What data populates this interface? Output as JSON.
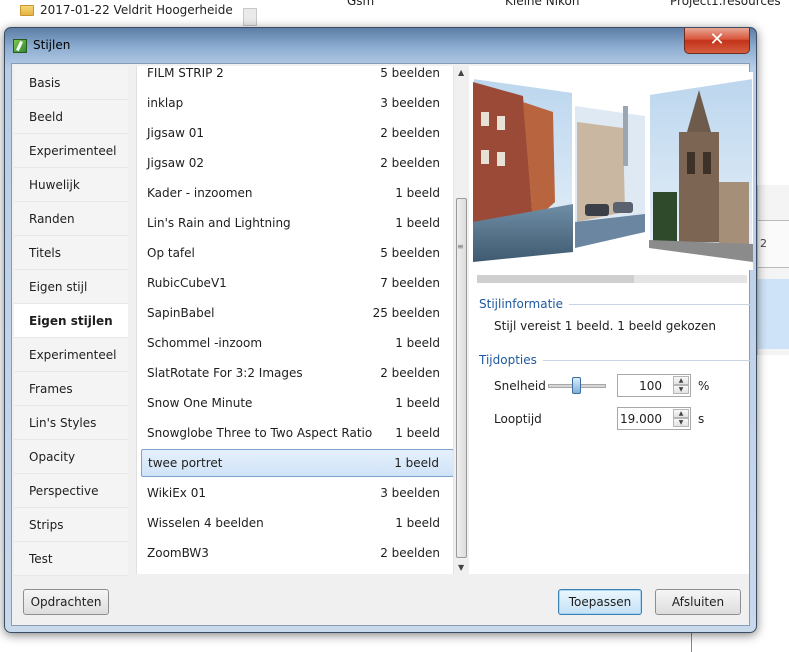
{
  "background": {
    "folder_label": "2017-01-22 Veldrit Hoogerheide",
    "columns": [
      "Gsm",
      "Kleine Nikon",
      "Project1.resources"
    ],
    "ruler_number": "2"
  },
  "dialog": {
    "title": "Stijlen",
    "close_glyph": "✕"
  },
  "categories": [
    {
      "label": "Basis"
    },
    {
      "label": "Beeld"
    },
    {
      "label": "Experimenteel"
    },
    {
      "label": "Huwelijk"
    },
    {
      "label": "Randen"
    },
    {
      "label": "Titels"
    },
    {
      "label": "Eigen stijl"
    },
    {
      "label": "Eigen stijlen",
      "selected": true
    },
    {
      "label": "Experimenteel"
    },
    {
      "label": "Frames"
    },
    {
      "label": "Lin's Styles"
    },
    {
      "label": "Opacity"
    },
    {
      "label": "Perspective"
    },
    {
      "label": "Strips"
    },
    {
      "label": "Test"
    }
  ],
  "styles": [
    {
      "name": "FILM STRIP 2",
      "count": "5 beelden"
    },
    {
      "name": "inklap",
      "count": "3 beelden"
    },
    {
      "name": "Jigsaw 01",
      "count": "2 beelden"
    },
    {
      "name": "Jigsaw 02",
      "count": "2 beelden"
    },
    {
      "name": "Kader - inzoomen",
      "count": "1 beeld"
    },
    {
      "name": "Lin's Rain and Lightning",
      "count": "1 beeld"
    },
    {
      "name": "Op tafel",
      "count": "5 beelden"
    },
    {
      "name": "RubicCubeV1",
      "count": "7 beelden"
    },
    {
      "name": "SapinBabel",
      "count": "25 beelden"
    },
    {
      "name": "Schommel -inzoom",
      "count": "1 beeld"
    },
    {
      "name": "SlatRotate For 3:2 Images",
      "count": "2 beelden"
    },
    {
      "name": "Snow One Minute",
      "count": "1 beeld"
    },
    {
      "name": "Snowglobe Three to Two Aspect Ratio",
      "count": "1 beeld"
    },
    {
      "name": "twee portret",
      "count": "1 beeld",
      "selected": true
    },
    {
      "name": "WikiEx 01",
      "count": "3 beelden"
    },
    {
      "name": "Wisselen 4 beelden",
      "count": "1 beeld"
    },
    {
      "name": "ZoomBW3",
      "count": "2 beelden"
    }
  ],
  "preview": {
    "progress_fraction": 0.58
  },
  "info": {
    "group_title": "Stijlinformatie",
    "text": "Stijl vereist 1 beeld. 1 beeld gekozen"
  },
  "timing": {
    "group_title": "Tijdopties",
    "speed_label": "Snelheid",
    "speed_value": "100",
    "speed_unit": "%",
    "speed_slider_fraction": 0.5,
    "duration_label": "Looptijd",
    "duration_value": "19.000",
    "duration_unit": "s"
  },
  "buttons": {
    "commands": "Opdrachten",
    "apply": "Toepassen",
    "close": "Afsluiten"
  },
  "colors": {
    "accent": "#1e5aa0",
    "selection": "#cfe3f8",
    "close_button": "#c1321a"
  }
}
